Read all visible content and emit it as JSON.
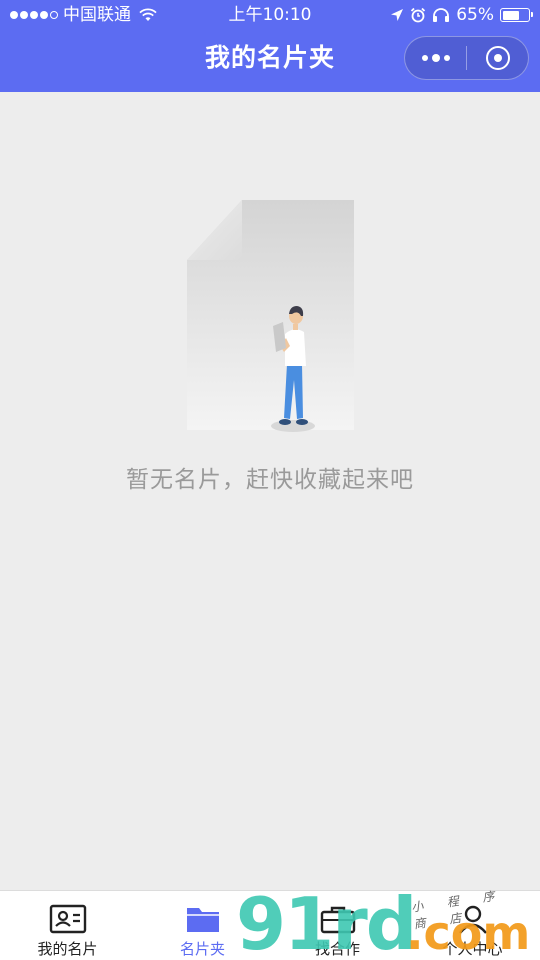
{
  "status_bar": {
    "carrier": "中国联通",
    "time": "上午10:10",
    "battery": "65%",
    "battery_level": 0.65,
    "signal_icon": "signal-dots-icon",
    "wifi_icon": "wifi-icon"
  },
  "nav": {
    "title": "我的名片夹",
    "more_icon": "more-dots-icon",
    "close_icon": "target-circle-icon"
  },
  "empty_state": {
    "illustration": "empty-document-person-illustration",
    "message": "暂无名片，赶快收藏起来吧"
  },
  "tabs": [
    {
      "label": "我的名片",
      "icon": "id-card-icon",
      "active": false
    },
    {
      "label": "名片夹",
      "icon": "folder-icon",
      "active": true
    },
    {
      "label": "找合作",
      "icon": "briefcase-icon",
      "active": false
    },
    {
      "label": "个人中心",
      "icon": "user-icon",
      "active": false
    }
  ],
  "watermark": {
    "main": "91rd",
    "suffix": ".com",
    "small_text": "小 程 序 商 店"
  },
  "colors": {
    "brand": "#5c6cf2",
    "background": "#ededed",
    "inactive_tab_icon": "#222222",
    "empty_text": "#9a9a9a"
  }
}
